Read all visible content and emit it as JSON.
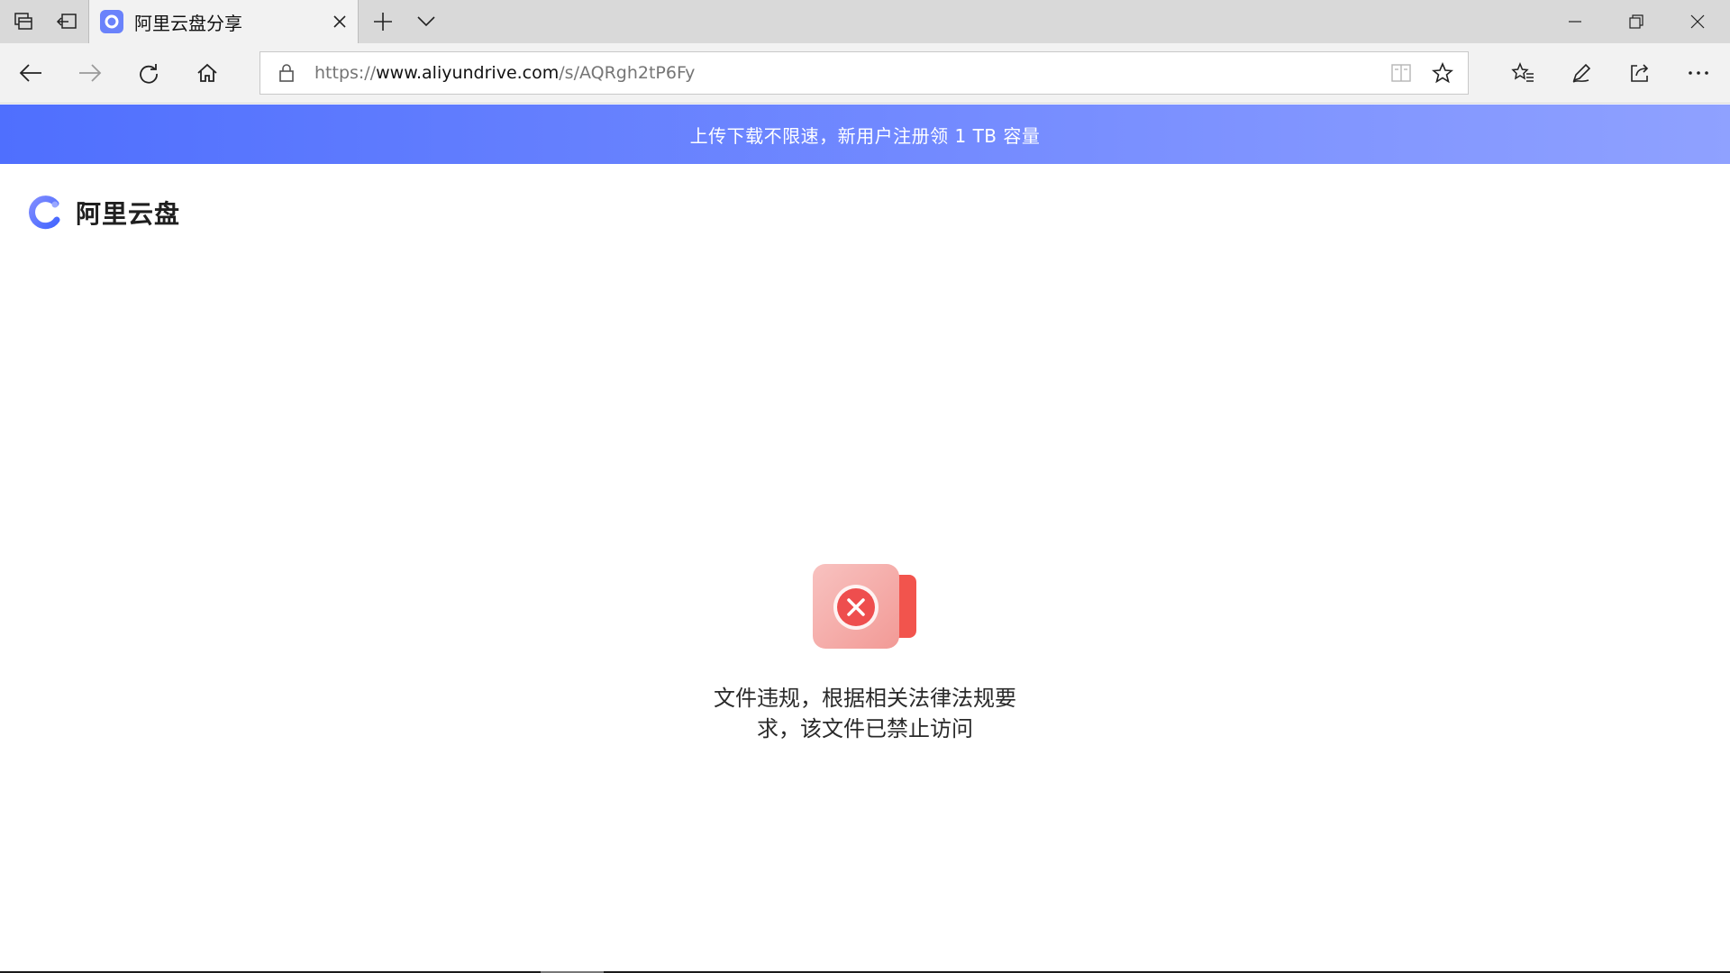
{
  "browser": {
    "tab": {
      "title": "阿里云盘分享"
    },
    "address": {
      "scheme": "https://",
      "host": "www.aliyundrive.com",
      "path": "/s/AQRgh2tP6Fy"
    },
    "icons": {
      "tab_actions": "tab-set-aside-icon",
      "back": "back-arrow-icon",
      "forward": "forward-arrow-icon",
      "refresh": "refresh-icon",
      "home": "home-icon",
      "lock": "lock-icon",
      "reading_view": "reading-view-icon",
      "favorite": "star-icon",
      "favorites_hub": "favorites-list-icon",
      "notes": "pen-icon",
      "share": "share-icon",
      "more": "more-icon"
    }
  },
  "page": {
    "banner": {
      "text": "上传下载不限速，新用户注册领 1 TB 容量"
    },
    "logo": {
      "text": "阿里云盘"
    },
    "error": {
      "line1": "文件违规，根据相关法律法规要",
      "line2": "求，该文件已禁止访问"
    }
  },
  "colors": {
    "banner_start": "#4f6ffe",
    "banner_end": "#8fa1ff",
    "logo_blue": "#5b78ff",
    "error_red": "#ee4e4e"
  }
}
